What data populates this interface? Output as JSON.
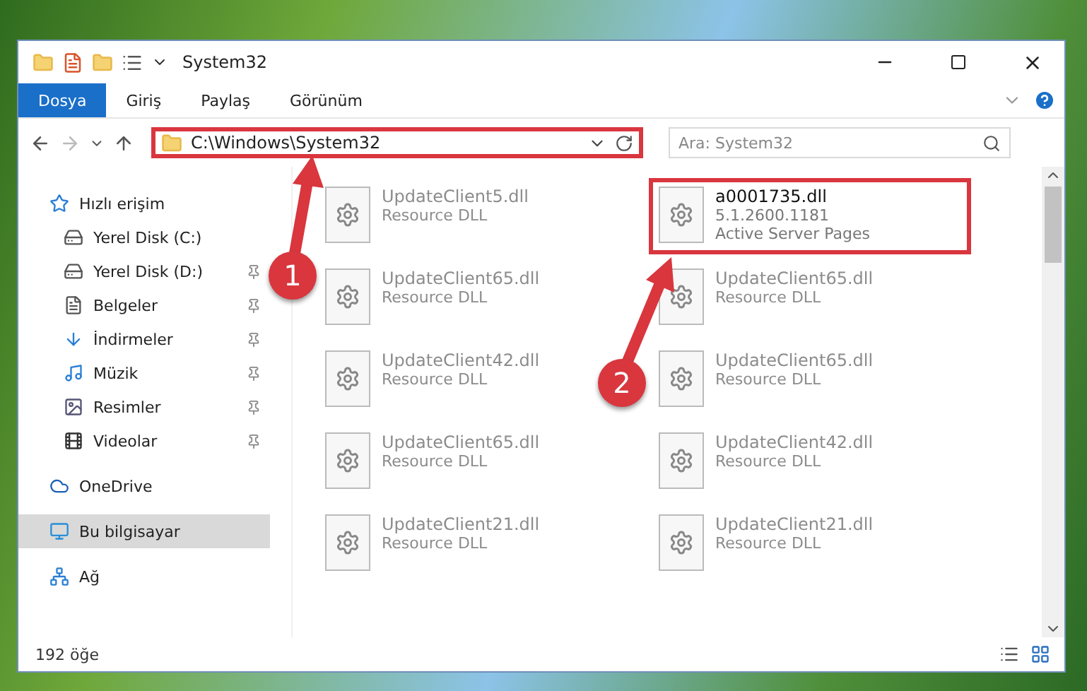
{
  "window": {
    "title": "System32"
  },
  "ribbon_tabs": [
    {
      "label": "Dosya",
      "selected": true
    },
    {
      "label": "Giriş",
      "selected": false
    },
    {
      "label": "Paylaş",
      "selected": false
    },
    {
      "label": "Görünüm",
      "selected": false
    }
  ],
  "address_bar": {
    "path": "C:\\Windows\\System32",
    "highlighted": true
  },
  "search": {
    "placeholder": "Ara: System32"
  },
  "sidebar": {
    "items": [
      {
        "label": "Hızlı erişim",
        "kind": "star",
        "selected": false,
        "children": [
          {
            "label": "Yerel Disk (C:)",
            "kind": "windrive",
            "selected": false,
            "pinned": false
          },
          {
            "label": "Yerel Disk (D:)",
            "kind": "drive",
            "selected": false,
            "pinned": true
          },
          {
            "label": "Belgeler",
            "kind": "documents",
            "selected": false,
            "pinned": true
          },
          {
            "label": "İndirmeler",
            "kind": "downloads",
            "selected": false,
            "pinned": true
          },
          {
            "label": "Müzik",
            "kind": "music",
            "selected": false,
            "pinned": true
          },
          {
            "label": "Resimler",
            "kind": "pictures",
            "selected": false,
            "pinned": true
          },
          {
            "label": "Videolar",
            "kind": "videos",
            "selected": false,
            "pinned": true
          }
        ]
      },
      {
        "label": "OneDrive",
        "kind": "cloud",
        "selected": false
      },
      {
        "label": "Bu bilgisayar",
        "kind": "computer",
        "selected": true
      },
      {
        "label": "Ağ",
        "kind": "network",
        "selected": false
      }
    ]
  },
  "files": [
    {
      "name": "UpdateClient5.dll",
      "details": [
        "Resource DLL"
      ],
      "dimmed": true,
      "highlighted": false
    },
    {
      "name": "a0001735.dll",
      "details": [
        "5.1.2600.1181",
        "Active Server Pages"
      ],
      "dimmed": false,
      "highlighted": true
    },
    {
      "name": "UpdateClient65.dll",
      "details": [
        "Resource DLL"
      ],
      "dimmed": true,
      "highlighted": false
    },
    {
      "name": "UpdateClient65.dll",
      "details": [
        "Resource DLL"
      ],
      "dimmed": true,
      "highlighted": false
    },
    {
      "name": "UpdateClient42.dll",
      "details": [
        "Resource DLL"
      ],
      "dimmed": true,
      "highlighted": false
    },
    {
      "name": "UpdateClient65.dll",
      "details": [
        "Resource DLL"
      ],
      "dimmed": true,
      "highlighted": false
    },
    {
      "name": "UpdateClient65.dll",
      "details": [
        "Resource DLL"
      ],
      "dimmed": true,
      "highlighted": false
    },
    {
      "name": "UpdateClient42.dll",
      "details": [
        "Resource DLL"
      ],
      "dimmed": true,
      "highlighted": false
    },
    {
      "name": "UpdateClient21.dll",
      "details": [
        "Resource DLL"
      ],
      "dimmed": true,
      "highlighted": false
    },
    {
      "name": "UpdateClient21.dll",
      "details": [
        "Resource DLL"
      ],
      "dimmed": true,
      "highlighted": false
    }
  ],
  "status_bar": {
    "count": "192 öğe"
  },
  "annotations": [
    {
      "label": "1"
    },
    {
      "label": "2"
    }
  ]
}
